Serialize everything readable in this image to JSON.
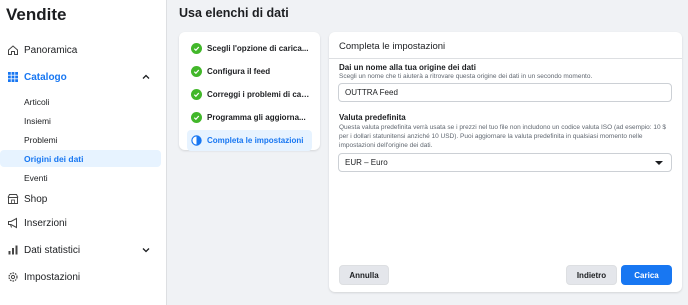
{
  "sidebar": {
    "title": "Vendite",
    "items": [
      {
        "label": "Panoramica",
        "icon": "home-icon"
      },
      {
        "label": "Catalogo",
        "icon": "grid-icon"
      },
      {
        "label": "Shop",
        "icon": "shop-icon"
      },
      {
        "label": "Inserzioni",
        "icon": "megaphone-icon"
      },
      {
        "label": "Dati statistici",
        "icon": "bar-chart-icon"
      },
      {
        "label": "Impostazioni",
        "icon": "gear-icon"
      }
    ],
    "catalog_subitems": [
      "Articoli",
      "Insiemi",
      "Problemi",
      "Origini dei dati",
      "Eventi"
    ],
    "selected_subitem": "Origini dei dati"
  },
  "page": {
    "title": "Usa elenchi di dati"
  },
  "steps": [
    {
      "label": "Scegli l'opzione di carica...",
      "status": "done"
    },
    {
      "label": "Configura il feed",
      "status": "done"
    },
    {
      "label": "Correggi i problemi di cari...",
      "status": "done"
    },
    {
      "label": "Programma gli aggiorna...",
      "status": "done"
    },
    {
      "label": "Completa le impostazioni",
      "status": "current"
    }
  ],
  "settings": {
    "title": "Completa le impostazioni",
    "name_label": "Dai un nome alla tua origine dei dati",
    "name_help": "Scegli un nome che ti aiuterà a ritrovare questa origine dei dati in un secondo momento.",
    "name_value": "OUTTRA Feed",
    "currency_label": "Valuta predefinita",
    "currency_help": "Questa valuta predefinita verrà usata se i prezzi nel tuo file non includono un codice valuta ISO (ad esempio: 10 $ per i dollari statunitensi anziché 10 USD). Puoi aggiornare la valuta predefinita in qualsiasi momento nelle impostazioni dell'origine dei dati.",
    "currency_value": "EUR – Euro",
    "cancel_label": "Annulla",
    "back_label": "Indietro",
    "upload_label": "Carica"
  },
  "colors": {
    "accent": "#1877f2",
    "success": "#42b72a",
    "selected_bg": "#e7f3ff"
  }
}
